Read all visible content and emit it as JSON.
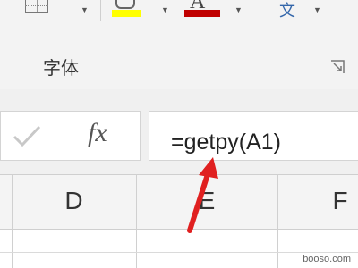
{
  "ribbon": {
    "group_label": "字体",
    "font_color_glyph": "A",
    "convert_glyph": "文",
    "fill_color": "#ffff00",
    "font_color": "#c00000",
    "icons": [
      "borders-icon",
      "fill-color-icon",
      "font-color-icon",
      "chinese-convert-icon",
      "dialog-launcher-icon"
    ]
  },
  "formula_bar": {
    "fx_label": "fx",
    "formula": "=getpy(A1)"
  },
  "grid": {
    "columns": [
      "D",
      "E",
      "F"
    ]
  },
  "annotation": {
    "arrow_color": "#e02020"
  },
  "watermark": "booso.com"
}
